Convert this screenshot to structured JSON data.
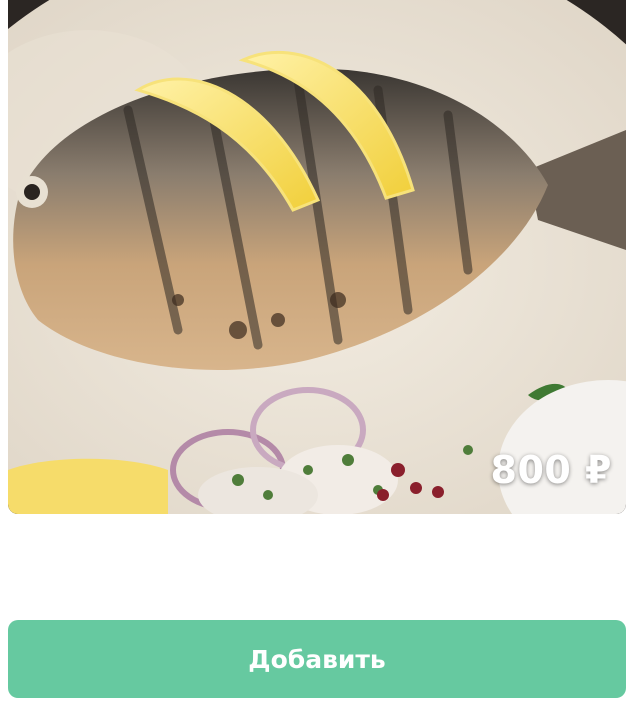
{
  "product": {
    "image_icon": "grilled-fish-photo",
    "price": "800 ₽"
  },
  "actions": {
    "add_label": "Добавить"
  },
  "colors": {
    "button_bg": "#66c9a0",
    "price_text": "#ffffff"
  }
}
